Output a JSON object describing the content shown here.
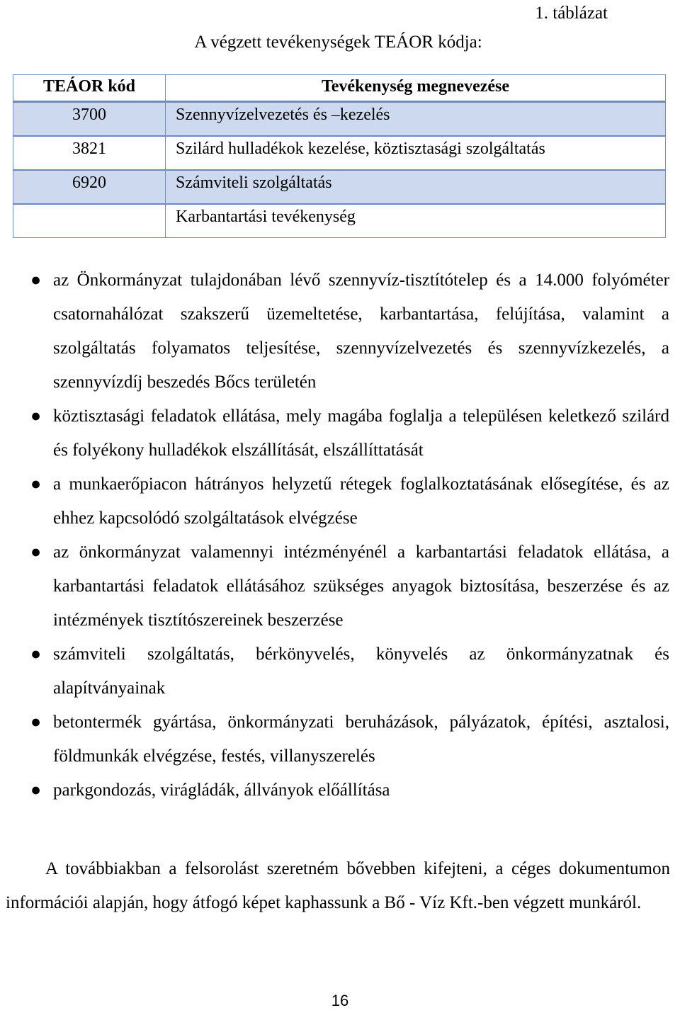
{
  "document": {
    "table_caption": "1. táblázat",
    "subtitle": "A végzett tevékenységek TEÁOR kódja:",
    "page_number": "16"
  },
  "table": {
    "headers": {
      "code": "TEÁOR kód",
      "name": "Tevékenység megnevezése"
    },
    "rows": [
      {
        "code": "3700",
        "name": "Szennyvízelvezetés és –kezelés"
      },
      {
        "code": "3821",
        "name": "Szilárd hulladékok kezelése, köztisztasági szolgáltatás"
      },
      {
        "code": "6920",
        "name": "Számviteli szolgáltatás"
      },
      {
        "code": "",
        "name": "Karbantartási tevékenység"
      }
    ]
  },
  "bullets": {
    "marker": "●",
    "items": [
      {
        "text": "az Önkormányzat tulajdonában lévő szennyvíz-tisztítótelep és a 14.000 folyóméter csatornahálózat szakszerű üzemeltetése, karbantartása, felújítása, valamint a szolgáltatás folyamatos teljesítése, szennyvízelvezetés és szennyvízkezelés, a szennyvízdíj beszedés Bőcs területén"
      },
      {
        "text": "köztisztasági feladatok ellátása, mely magába foglalja a településen keletkező szilárd és folyékony hulladékok elszállítását, elszállíttatását"
      },
      {
        "text": "a munkaerőpiacon hátrányos helyzetű rétegek foglalkoztatásának elősegítése, és az ehhez kapcsolódó szolgáltatások elvégzése"
      },
      {
        "text": "az önkormányzat valamennyi intézményénél a karbantartási feladatok ellátása, a karbantartási feladatok ellátásához szükséges anyagok biztosítása, beszerzése és az intézmények tisztítószereinek beszerzése"
      },
      {
        "text": "számviteli szolgáltatás, bérkönyvelés, könyvelés az önkormányzatnak és alapítványainak"
      },
      {
        "text": "betontermék gyártása, önkormányzati beruházások, pályázatok, építési, asztalosi, földmunkák elvégzése, festés, villanyszerelés"
      },
      {
        "text": "parkgondozás, virágládák, állványok előállítása"
      }
    ]
  },
  "closing_paragraph": "A továbbiakban a felsorolást szeretném bővebben kifejteni, a céges dokumentumon információi alapján, hogy átfogó képet kaphassunk a Bő - Víz Kft.-ben végzett munkáról.",
  "colors": {
    "table_border": "#7390bd",
    "shaded_row": "#ccd9ee",
    "text": "#000000",
    "page_background": "#ffffff"
  }
}
